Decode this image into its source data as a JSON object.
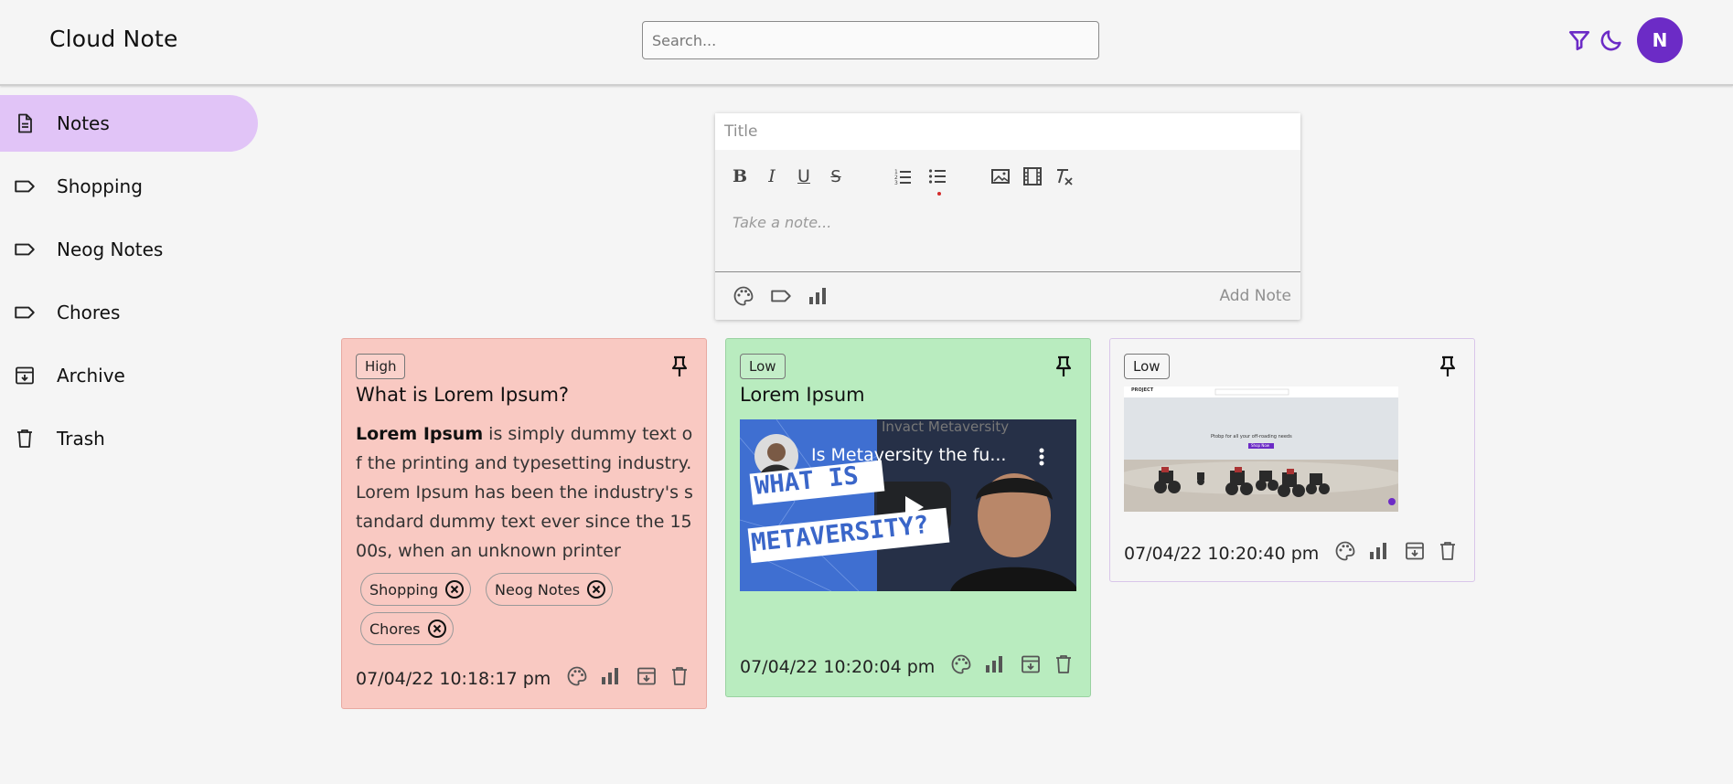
{
  "header": {
    "app_title": "Cloud Note",
    "search_placeholder": "Search...",
    "avatar_letter": "N",
    "accent": "#6c2bc6"
  },
  "sidebar": {
    "items": [
      {
        "label": "Notes",
        "icon": "note-icon",
        "active": true
      },
      {
        "label": "Shopping",
        "icon": "label-icon"
      },
      {
        "label": "Neog Notes",
        "icon": "label-icon"
      },
      {
        "label": "Chores",
        "icon": "label-icon"
      },
      {
        "label": "Archive",
        "icon": "archive-icon"
      },
      {
        "label": "Trash",
        "icon": "trash-icon"
      }
    ],
    "active_color": "#e1c4f7"
  },
  "editor": {
    "title_placeholder": "Title",
    "body_placeholder": "Take a note...",
    "add_note_label": "Add Note",
    "toolbar": [
      "bold-icon",
      "italic-icon",
      "underline-icon",
      "strike-icon",
      "ordered-list-icon",
      "bullet-list-icon",
      "image-icon",
      "video-icon",
      "clear-format-icon"
    ]
  },
  "notes": [
    {
      "priority": "High",
      "title": "What is Lorem Ipsum?",
      "body_bold": "Lorem Ipsum",
      "body_rest": " is simply dummy text of the printing and typesetting industry. Lorem Ipsum has been the industry's standard dummy text ever since the 1500s, when an unknown printer",
      "labels": [
        "Shopping",
        "Neog Notes",
        "Chores"
      ],
      "date": "07/04/22 10:18:17 pm",
      "bg": "#f9c9c2"
    },
    {
      "priority": "Low",
      "title": "Lorem Ipsum",
      "video": {
        "title": "Is Metaversity the fu...",
        "overlay_text_1": "WHAT IS",
        "overlay_text_2": "METAVERSITY?",
        "channel_text": "Invact Metaversity"
      },
      "date": "07/04/22 10:20:04 pm",
      "bg": "#b9ecbf"
    },
    {
      "priority": "Low",
      "image": {
        "brand": "PROJECT",
        "headline": "Ptobp for all your off-roading needs",
        "button": "Shop Now"
      },
      "date": "07/04/22 10:20:40 pm",
      "bg": "#f5f5f5"
    }
  ]
}
